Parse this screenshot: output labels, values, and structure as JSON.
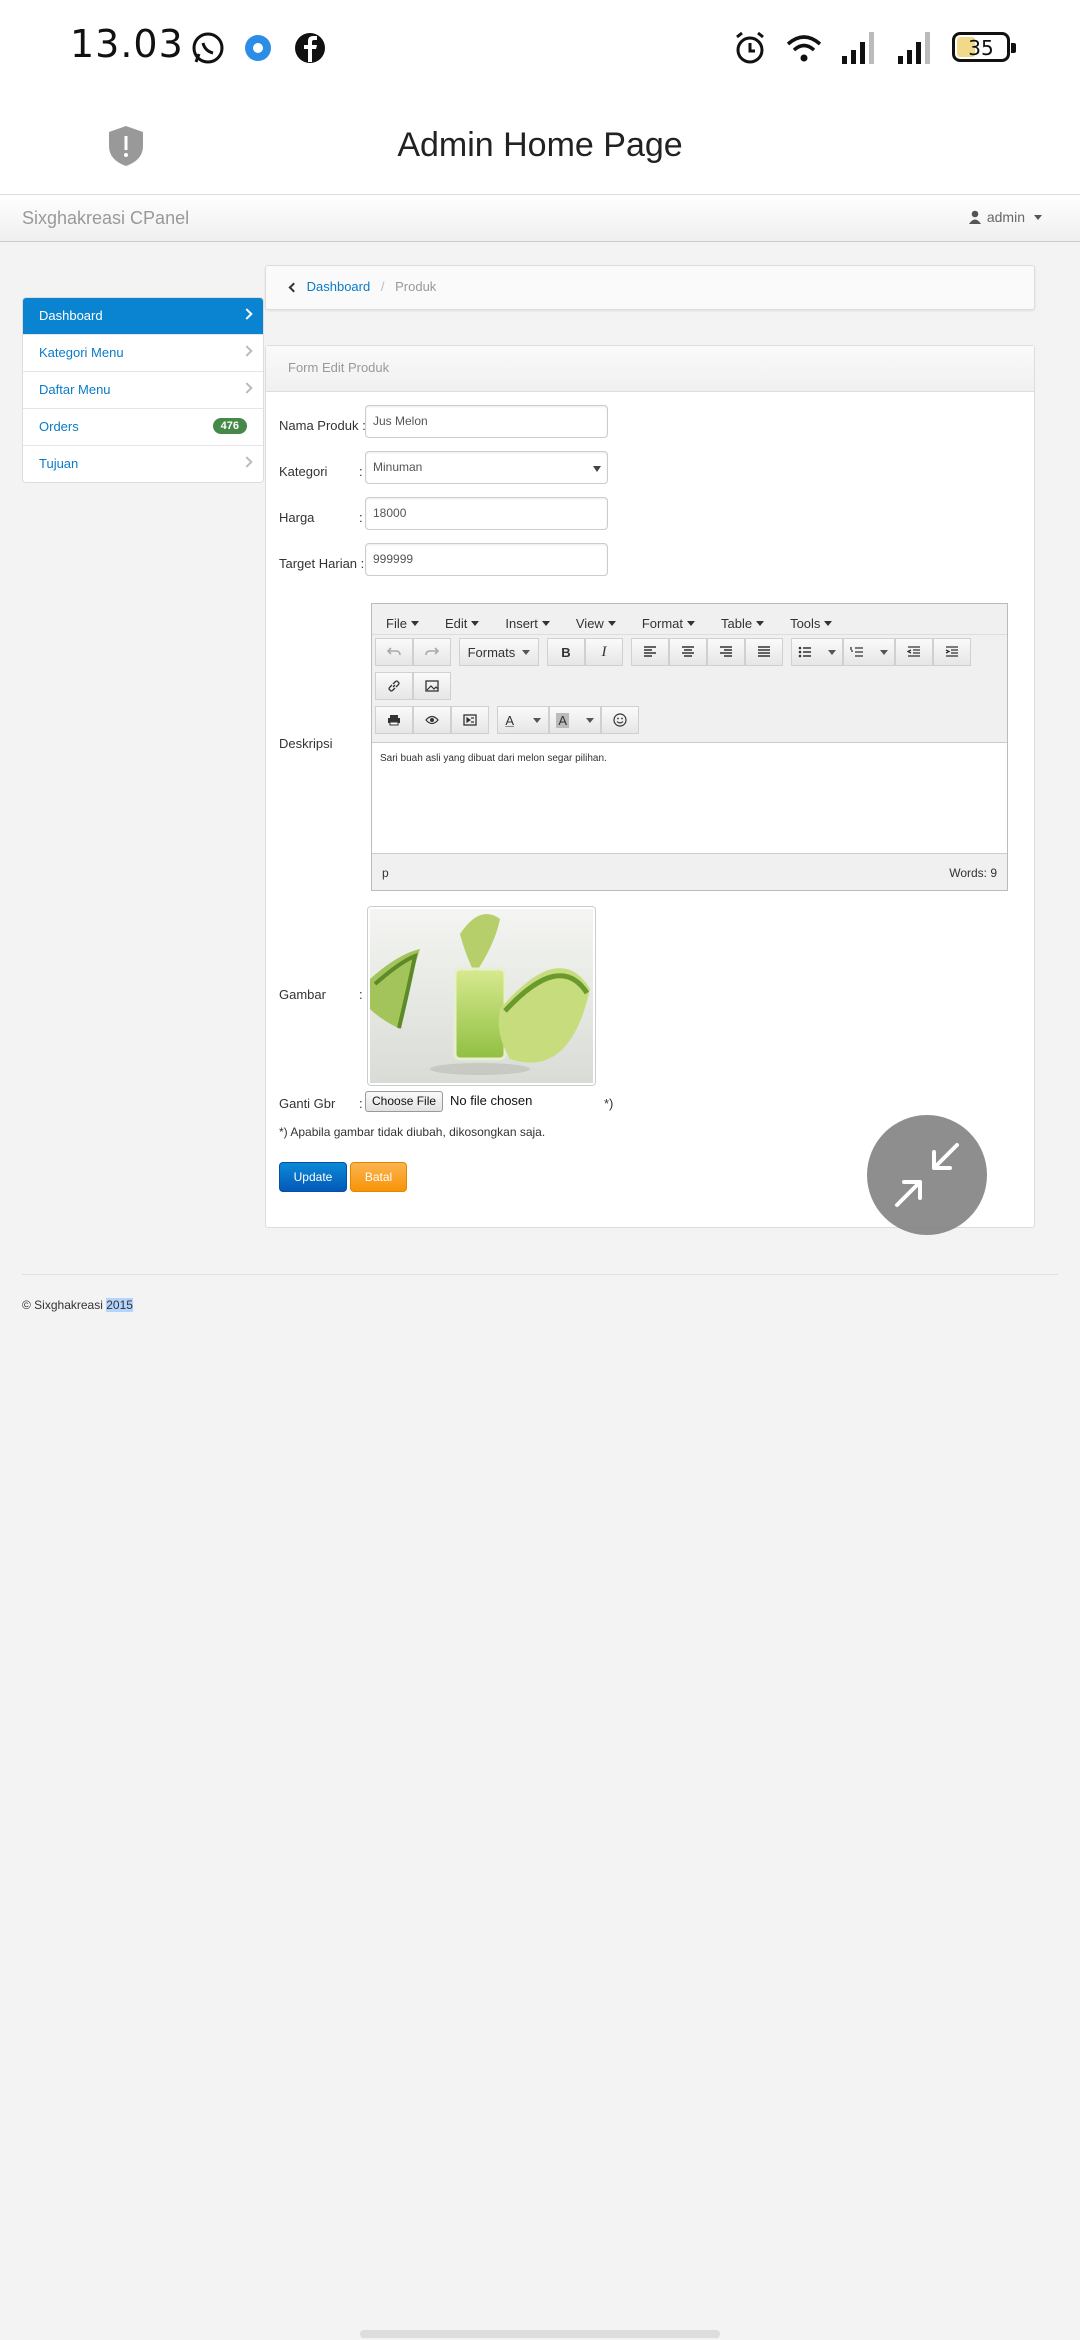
{
  "status_bar": {
    "time": "13.03",
    "battery": "35",
    "icons": [
      "whatsapp-icon",
      "chat-bubble-icon",
      "facebook-icon",
      "alarm-icon",
      "wifi-icon",
      "signal-icon",
      "signal-icon"
    ]
  },
  "title_bar": {
    "title": "Admin Home Page",
    "icon": "shield-alert-icon"
  },
  "navbar": {
    "brand": "Sixghakreasi CPanel",
    "user": "admin"
  },
  "sidebar": {
    "items": [
      {
        "label": "Dashboard",
        "active": true
      },
      {
        "label": "Kategori Menu"
      },
      {
        "label": "Daftar Menu"
      },
      {
        "label": "Orders",
        "badge": "476"
      },
      {
        "label": "Tujuan"
      }
    ]
  },
  "breadcrumb": {
    "link": "Dashboard",
    "separator": "/",
    "current": "Produk"
  },
  "form": {
    "title": "Form Edit Produk",
    "fields": {
      "nama_label": "Nama Produk :",
      "nama_value": "Jus Melon",
      "kategori_label": "Kategori",
      "kategori_value": "Minuman",
      "harga_label": "Harga",
      "harga_value": "18000",
      "target_label": "Target Harian :",
      "target_value": "999999",
      "deskripsi_label": "Deskripsi",
      "gambar_label": "Gambar",
      "ganti_label": "Ganti Gbr",
      "colon": ":"
    },
    "editor": {
      "menus": [
        "File",
        "Edit",
        "Insert",
        "View",
        "Format",
        "Table",
        "Tools"
      ],
      "formats_label": "Formats",
      "bold": "B",
      "italic": "I",
      "font_color": "A",
      "bg_color": "A",
      "content": "Sari buah asli yang dibuat dari melon segar pilihan.",
      "path": "p",
      "words": "Words: 9"
    },
    "file": {
      "button": "Choose File",
      "status": "No file chosen",
      "marker": "*)"
    },
    "note": "*) Apabila gambar tidak diubah, dikosongkan saja.",
    "buttons": {
      "update": "Update",
      "batal": "Batal"
    }
  },
  "footer": {
    "copyright": "© Sixghakreasi ",
    "year": "2015"
  },
  "colors": {
    "primary": "#0a84d0",
    "badge": "#468847",
    "warning": "#f89406"
  }
}
